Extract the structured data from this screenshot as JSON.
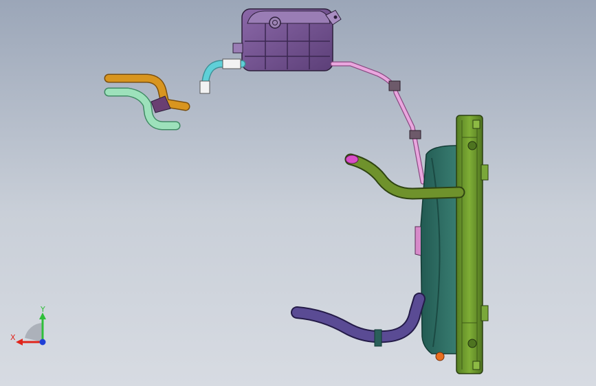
{
  "viewport": {
    "background_top": "#9ba6b8",
    "background_bottom": "#d7dbe2"
  },
  "triad": {
    "x_label": "X",
    "y_label": "Y",
    "x_color": "#e0241b",
    "y_color": "#2fbf3a",
    "z_color": "#1f3fd6"
  },
  "parts": {
    "expansion_tank": {
      "color": "#7e5a9a"
    },
    "tank_pink_hose": {
      "color": "#e7a0d8"
    },
    "tank_cyan_hose": {
      "color": "#4fc7cf"
    },
    "orange_hose": {
      "color": "#c98a1f"
    },
    "mint_hose": {
      "color": "#8fd8b0"
    },
    "radiator_core": {
      "color": "#6f9a2e"
    },
    "fan_shroud": {
      "color": "#2f6f64"
    },
    "upper_hose": {
      "color": "#5f7f2a"
    },
    "lower_hose": {
      "color": "#4a3e7a"
    },
    "drain_valve": {
      "color": "#e36b1d"
    }
  }
}
